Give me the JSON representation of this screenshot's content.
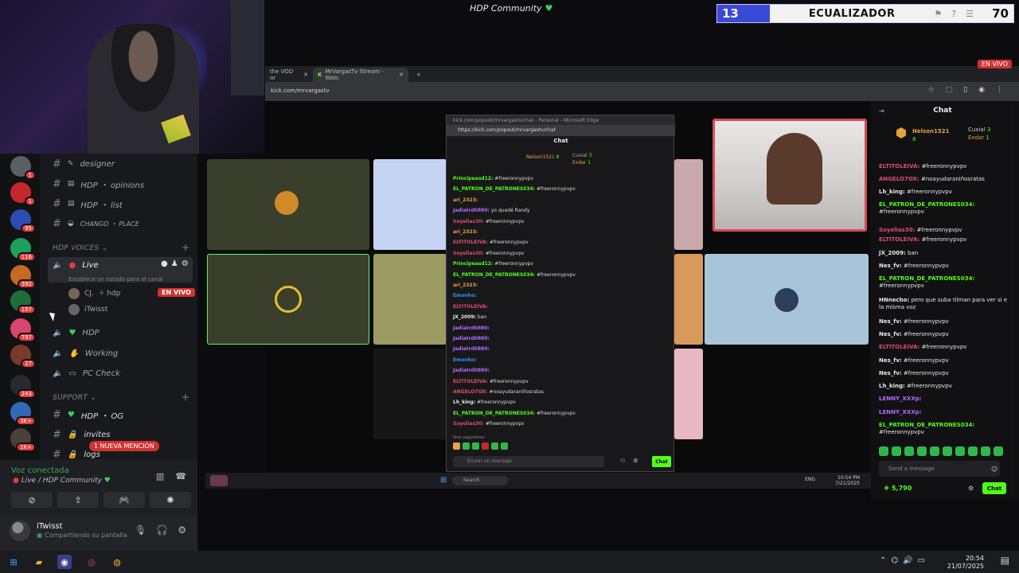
{
  "overlay": {
    "community_title": "HDP Community",
    "equalizer_label": "ECUALIZADOR",
    "equalizer_left_value": "13",
    "equalizer_right_value": "70"
  },
  "discord": {
    "servers": [
      {
        "badge": "1",
        "color": "#5b5f66"
      },
      {
        "badge": "1",
        "color": "#c4282b"
      },
      {
        "badge": "95",
        "color": "#2c4db3"
      },
      {
        "badge": "116",
        "color": "#1f9f5c"
      },
      {
        "badge": "392",
        "color": "#c46a25"
      },
      {
        "badge": "157",
        "color": "#1d6e3b"
      },
      {
        "badge": "797",
        "color": "#d9456e"
      },
      {
        "badge": "27",
        "color": "#7a3a2a"
      },
      {
        "badge": "243",
        "color": "#272a30"
      },
      {
        "badge": "3K+",
        "color": "#2f6ab3"
      },
      {
        "badge": "1K+",
        "color": "#4a4036"
      }
    ],
    "text_channels_top": [
      {
        "name": "designer",
        "emoji": "✎"
      },
      {
        "name": "HDP ・ opinions",
        "emoji": "▤"
      },
      {
        "name": "HDP ・ list",
        "emoji": "▤"
      },
      {
        "name": "CHANGO ・ PLACE",
        "emoji": "◒"
      }
    ],
    "voice_category": "HDP VOICES",
    "live_channel": "Live",
    "live_status_placeholder": "Establece un estado para el canal",
    "live_members": [
      {
        "name": "CJ.",
        "tag": "✧ hdp"
      },
      {
        "name": "iTwisst",
        "tag": ""
      }
    ],
    "live_badge": "EN VIVO",
    "voice_channels": [
      "HDP",
      "Working",
      "PC Check"
    ],
    "support_category": "SUPPORT",
    "support_channels": [
      "HDP ・ OG",
      "invites",
      "logs"
    ],
    "mention_pill": "1 NUEVA MENCIÓN",
    "voice_connected": "Voz conectada",
    "voice_location": "Live / HDP Community",
    "user": {
      "name": "iTwisst",
      "status": "Compartiendo su pantalla"
    }
  },
  "browser": {
    "tabs": [
      {
        "label": "the VOD or"
      },
      {
        "label": "MrVargasTv Stream - Watc"
      }
    ],
    "url": "kick.com/mrvargastv",
    "en_vivo": "EN VIVO"
  },
  "popout": {
    "window_title": "kick.com/popout/mrvargastv/chat - Personal - Microsoft Edge",
    "url": "https://kick.com/popout/mrvargastv/chat",
    "heading": "Chat",
    "gifters": [
      {
        "name": "Nelson1521",
        "count": "8"
      },
      {
        "name": "Cuxial",
        "count": "3"
      },
      {
        "name": "Exdar",
        "count": "1"
      }
    ],
    "lines": [
      {
        "user": "Principeasd12:",
        "text": "#freeronnypvpv",
        "color": "#53fc18"
      },
      {
        "user": "EL_PATRON_DE_PATRONES034:",
        "text": "#freeronnypvpv",
        "color": "#53fc18"
      },
      {
        "user": "ari_2323:",
        "text": "",
        "color": "#e6a23c"
      },
      {
        "user": "Jadiatrd0880:",
        "text": "yo quedé Randy",
        "color": "#b36bff"
      },
      {
        "user": "Soyelias30:",
        "text": "#freeronnypvpv",
        "color": "#e04b6e"
      },
      {
        "user": "ari_2323:",
        "text": "",
        "color": "#e6a23c"
      },
      {
        "user": "ELTITOLEIVA:",
        "text": "#freeronnypvpv",
        "color": "#e04b6e"
      },
      {
        "user": "Soyelias30:",
        "text": "#freeronnypvpv",
        "color": "#e04b6e"
      },
      {
        "user": "Principeasd12:",
        "text": "#freeronnypvpv",
        "color": "#53fc18"
      },
      {
        "user": "EL_PATRON_DE_PATRONES034:",
        "text": "#freeronnypvpv",
        "color": "#53fc18"
      },
      {
        "user": "ari_2323:",
        "text": "",
        "color": "#e6a23c"
      },
      {
        "user": "Emonho:",
        "text": "",
        "color": "#3c8dff"
      },
      {
        "user": "ELTITOLEIVA:",
        "text": "",
        "color": "#e04b6e"
      },
      {
        "user": "JX_2009:",
        "text": "ban",
        "color": "#e8e8e8"
      },
      {
        "user": "Jadiatrd0880:",
        "text": "",
        "color": "#b36bff"
      },
      {
        "user": "Jadiatrd0880:",
        "text": "",
        "color": "#b36bff"
      },
      {
        "user": "Jadiatrd0880:",
        "text": "",
        "color": "#b36bff"
      },
      {
        "user": "Emonho:",
        "text": "",
        "color": "#3c8dff"
      },
      {
        "user": "Jadiatrd0880:",
        "text": "",
        "color": "#b36bff"
      },
      {
        "user": "ELTITOLEIVA:",
        "text": "#freeronnypvpv",
        "color": "#e04b6e"
      },
      {
        "user": "ANGELO7OX:",
        "text": "#noayudaraniñosratas",
        "color": "#e04b6e"
      },
      {
        "user": "Lh_king:",
        "text": "#freeronnypvpv",
        "color": "#e8e8e8"
      },
      {
        "user": "EL_PATRON_DE_PATRONES034:",
        "text": "#freeronnypvpv",
        "color": "#53fc18"
      },
      {
        "user": "Soyelias30:",
        "text": "#freeronnypvpv",
        "color": "#e04b6e"
      }
    ],
    "followers_only": "Solo seguidores",
    "input_placeholder": "Enviar un mensaje",
    "chat_button": "Chat"
  },
  "inner_taskbar": {
    "search": "Search",
    "lang": "ENG",
    "time": "10:54 PM",
    "date": "7/21/2025"
  },
  "kick_chat": {
    "heading": "Chat",
    "gifters": [
      {
        "name": "Nelson1521",
        "count": "8"
      },
      {
        "name": "Cuxial",
        "count": "3"
      },
      {
        "name": "Exdar",
        "count": "1"
      }
    ],
    "messages": [
      {
        "user": "ELTITOLEIVA:",
        "text": "#freeronnypvpv",
        "color": "#e04b6e"
      },
      {
        "user": "ANGELO7OX:",
        "text": "#noayudaraniñosratas",
        "color": "#e04b6e"
      },
      {
        "user": "Lh_king:",
        "text": "#freeronnypvpv",
        "color": "#e8e8e8"
      },
      {
        "user": "EL_PATRON_DE_PATRONES034:",
        "text": "#freeronnypvpv",
        "color": "#53fc18"
      },
      {
        "user": "Soyelias30:",
        "text": "#freeronnypvpv",
        "color": "#e04b6e"
      },
      {
        "user": "ELTITOLEIVA:",
        "text": "#freeronnypvpv",
        "color": "#e04b6e"
      },
      {
        "user": "JX_2009:",
        "text": "ban",
        "color": "#e8e8e8"
      },
      {
        "user": "Nes_fv:",
        "text": "#freeronnypvpv",
        "color": "#e8e8e8"
      },
      {
        "user": "EL_PATRON_DE_PATRONES034:",
        "text": "#freeronnypvpv",
        "color": "#53fc18"
      },
      {
        "user": "HNnecho:",
        "text": "pero que suba tilman para ver si e la misma voz",
        "color": "#e8e8e8"
      },
      {
        "user": "Nes_fv:",
        "text": "#freeronnypvpv",
        "color": "#e8e8e8"
      },
      {
        "user": "Nes_fv:",
        "text": "#freeronnypvpv",
        "color": "#e8e8e8"
      },
      {
        "user": "ELTITOLEIVA:",
        "text": "#freeronnypvpv",
        "color": "#e04b6e"
      },
      {
        "user": "Nes_fv:",
        "text": "#freeronnypvpv",
        "color": "#e8e8e8"
      },
      {
        "user": "Nes_fv:",
        "text": "#freeronnypvpv",
        "color": "#e8e8e8"
      },
      {
        "user": "Lh_king:",
        "text": "#freeronnypvpv",
        "color": "#e8e8e8"
      },
      {
        "user": "LENNY_XXXp:",
        "text": "",
        "color": "#b36bff"
      },
      {
        "user": "LENNY_XXXp:",
        "text": "",
        "color": "#b36bff"
      },
      {
        "user": "EL_PATRON_DE_PATRONES034:",
        "text": "#freeronnypvpv",
        "color": "#53fc18"
      }
    ],
    "input_placeholder": "Send a message",
    "points": "5,790",
    "chat_button": "Chat"
  },
  "taskbar": {
    "time": "20:54",
    "date": "21/07/2025"
  }
}
